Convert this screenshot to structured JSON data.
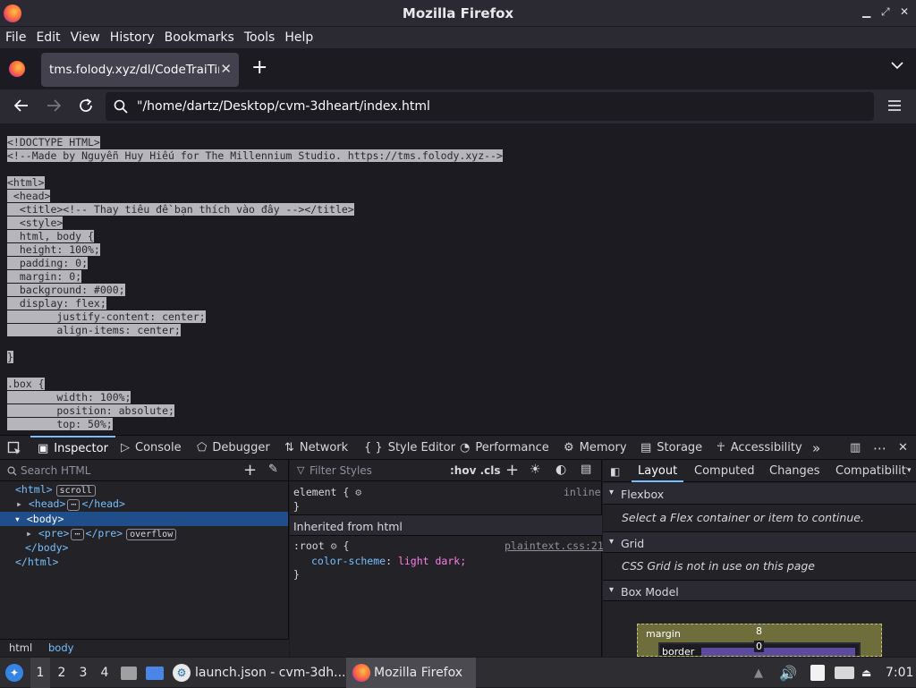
{
  "window": {
    "title": "Mozilla Firefox"
  },
  "menu": [
    "File",
    "Edit",
    "View",
    "History",
    "Bookmarks",
    "Tools",
    "Help"
  ],
  "tab": {
    "label": "tms.folody.xyz/dl/CodeTraiTim"
  },
  "address": {
    "url": "\"/home/dartz/Desktop/cvm-3dheart/index.html"
  },
  "source_lines": [
    "<!DOCTYPE HTML>",
    "<!--Made by Nguyễn Huy Hiếu for The Millennium Studio. https://tms.folody.xyz-->",
    "",
    "<html>",
    " <head>",
    "  <title><!-- Thay tiêu đề bạn thích vào đây --></title>",
    "  <style>",
    "  html, body {",
    "  height: 100%;",
    "  padding: 0;",
    "  margin: 0;",
    "  background: #000;",
    "  display: flex;",
    "        justify-content: center;",
    "        align-items: center;",
    "",
    "}",
    "",
    ".box {",
    "        width: 100%;",
    "        position: absolute;",
    "        top: 50%;"
  ],
  "devtools": {
    "tabs": [
      "Inspector",
      "Console",
      "Debugger",
      "Network",
      "Style Editor",
      "Performance",
      "Memory",
      "Storage",
      "Accessibility"
    ],
    "search_placeholder": "Search HTML",
    "markup": {
      "html": "<html>",
      "scroll_badge": "scroll",
      "head": "<head>",
      "head_close": "</head>",
      "body": "<body>",
      "pre": "<pre>",
      "pre_close": "</pre>",
      "overflow_badge": "overflow",
      "body_close": "</body>",
      "html_close": "</html>"
    },
    "breadcrumb": [
      "html",
      "body"
    ],
    "rules": {
      "filter_placeholder": "Filter Styles",
      "hov_cls": ":hov .cls",
      "element_selector": "element {",
      "element_source": "inline",
      "close_brace": "}",
      "inherited_header": "Inherited from html",
      "root_selector": ":root",
      "root_open": "{",
      "root_source": "plaintext.css:21",
      "prop_name": "color-scheme",
      "prop_value": "light dark;"
    },
    "layout": {
      "tabs": [
        "Layout",
        "Computed",
        "Changes",
        "Compatibility"
      ],
      "flexbox_title": "Flexbox",
      "flexbox_msg": "Select a Flex container or item to continue.",
      "grid_title": "Grid",
      "grid_msg": "CSS Grid is not in use on this page",
      "boxmodel_title": "Box Model",
      "margin_label": "margin",
      "margin_value": "8",
      "border_label": "border",
      "border_value": "0"
    }
  },
  "taskbar": {
    "workspaces": [
      "1",
      "2",
      "3",
      "4"
    ],
    "vscode_label": "launch.json - cvm-3dh...",
    "firefox_label": "Mozilla Firefox",
    "clock": "7:01"
  },
  "colors": {
    "accent": "#75bfff",
    "selection": "#204e8a",
    "text_selection": "#b5b5bb"
  }
}
